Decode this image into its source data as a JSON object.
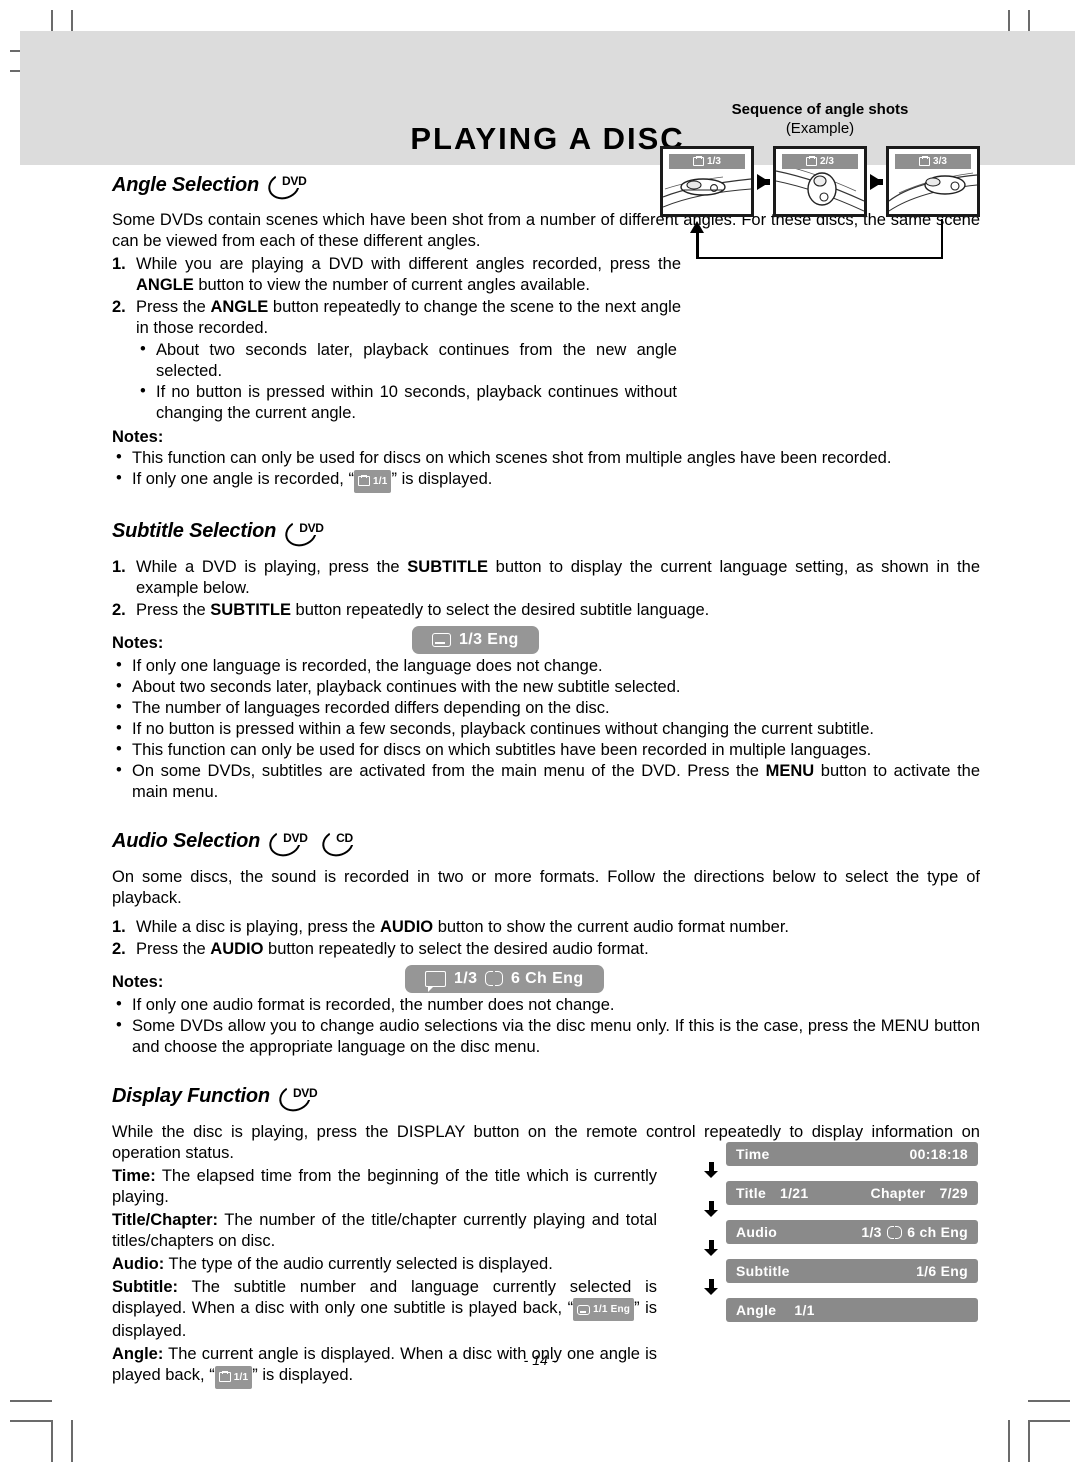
{
  "page": {
    "title": "PLAYING A DISC",
    "page_number": "- 14 -"
  },
  "angle_section": {
    "heading": "Angle Selection",
    "disc_badge": "DVD",
    "intro": "Some DVDs contain scenes which have been shot from a number of different angles. For these discs, the same scene can be viewed from each of these different angles.",
    "steps": [
      {
        "num": "1.",
        "text_a": "While you are playing a DVD with different angles recorded, press the ",
        "bold": "ANGLE",
        "text_b": " button to view the number of current angles available."
      },
      {
        "num": "2.",
        "text_a": "Press the ",
        "bold": "ANGLE",
        "text_b": " button repeatedly to change the scene to the next angle in those recorded."
      }
    ],
    "sub_bullets": [
      "About two seconds later, playback continues from the new angle selected.",
      "If no button is pressed within 10 seconds, playback continues without changing the current angle."
    ],
    "notes_label": "Notes:",
    "notes": [
      "This function can only be used for discs on which scenes shot from multiple angles have been recorded."
    ],
    "note_badge_prefix": "If only one angle is recorded, “",
    "note_badge_value": "1/1",
    "note_badge_suffix": "” is displayed."
  },
  "sequence_figure": {
    "title": "Sequence of angle shots",
    "subtitle": "(Example)",
    "frames": [
      {
        "badge": "1/3"
      },
      {
        "badge": "2/3"
      },
      {
        "badge": "3/3"
      }
    ]
  },
  "subtitle_section": {
    "heading": "Subtitle Selection",
    "disc_badge": "DVD",
    "steps": [
      {
        "num": "1.",
        "text_a": "While a DVD is playing, press the ",
        "bold": "SUBTITLE",
        "text_b": " button to display the current language setting, as shown in the example below."
      },
      {
        "num": "2.",
        "text_a": "Press the ",
        "bold": "SUBTITLE",
        "text_b": " button repeatedly to select the desired subtitle language."
      }
    ],
    "osd_badge": "1/3 Eng",
    "notes_label": "Notes:",
    "notes": [
      "If only one language is recorded, the language does not change.",
      "About two seconds later, playback continues with the new subtitle selected.",
      "The number of languages recorded differs depending on the disc.",
      "If no button is pressed within a few seconds, playback continues without changing the current subtitle.",
      "This function can only be used for discs on which subtitles have been recorded in multiple languages."
    ],
    "note_menu_a": "On some DVDs, subtitles are activated from the main menu of the DVD. Press the ",
    "note_menu_bold": "MENU",
    "note_menu_b": " button to activate the main menu."
  },
  "audio_section": {
    "heading": "Audio Selection",
    "disc_badges": [
      "DVD",
      "CD"
    ],
    "intro": "On some discs, the sound is recorded in two or more formats. Follow the directions below to select the type of playback.",
    "steps": [
      {
        "num": "1.",
        "text_a": "While a disc is playing, press the ",
        "bold": "AUDIO",
        "text_b": " button to show the current audio format number."
      },
      {
        "num": "2.",
        "text_a": "Press the ",
        "bold": "AUDIO",
        "text_b": " button repeatedly to select the desired audio format."
      }
    ],
    "osd_badge_num": "1/3",
    "osd_badge_tail": "6 Ch  Eng",
    "notes_label": "Notes:",
    "notes": [
      "If only one audio format is recorded, the number does not change.",
      "Some DVDs allow you to change audio selections via the disc menu only. If this is the case, press the MENU button and choose the appropriate language on the disc menu."
    ]
  },
  "display_section": {
    "heading": "Display Function",
    "disc_badge": "DVD",
    "intro": "While the disc is playing, press the DISPLAY button on the remote control repeatedly to display information on operation status.",
    "items": [
      {
        "label": "Time:",
        "text": " The elapsed time from the beginning of the title which is currently playing."
      },
      {
        "label": "Title/Chapter:",
        "text": " The number of the title/chapter currently playing and total titles/chapters on disc."
      },
      {
        "label": "Audio:",
        "text": " The type of the audio currently selected is displayed."
      }
    ],
    "subtitle_item": {
      "label": "Subtitle:",
      "text_a": " The subtitle number and language currently selected is displayed. When a disc with only one subtitle is played back, “",
      "badge": "1/1 Eng",
      "text_b": "” is displayed."
    },
    "angle_item": {
      "label": "Angle:",
      "text_a": " The current angle is displayed. When a disc with only one angle is played back, “",
      "badge": "1/1",
      "text_b": "” is displayed."
    },
    "osd_panels": [
      {
        "key": "Time",
        "value": "00:18:18",
        "value2": "",
        "key2": "",
        "dolby": false
      },
      {
        "key": "Title",
        "value": "1/21",
        "key2": "Chapter",
        "value2": "7/29",
        "dolby": false
      },
      {
        "key": "Audio",
        "value": "1/3",
        "value2": "6 ch  Eng",
        "key2": "",
        "dolby": true
      },
      {
        "key": "Subtitle",
        "value": "1/6 Eng",
        "value2": "",
        "key2": "",
        "dolby": false
      },
      {
        "key": "Angle",
        "value": "1/1",
        "value2": "",
        "key2": "",
        "dolby": false
      }
    ]
  },
  "colors": {
    "header_band": "#dcdcdc",
    "osd_gray": "#8a8a8a",
    "badge_gray": "#969696"
  }
}
